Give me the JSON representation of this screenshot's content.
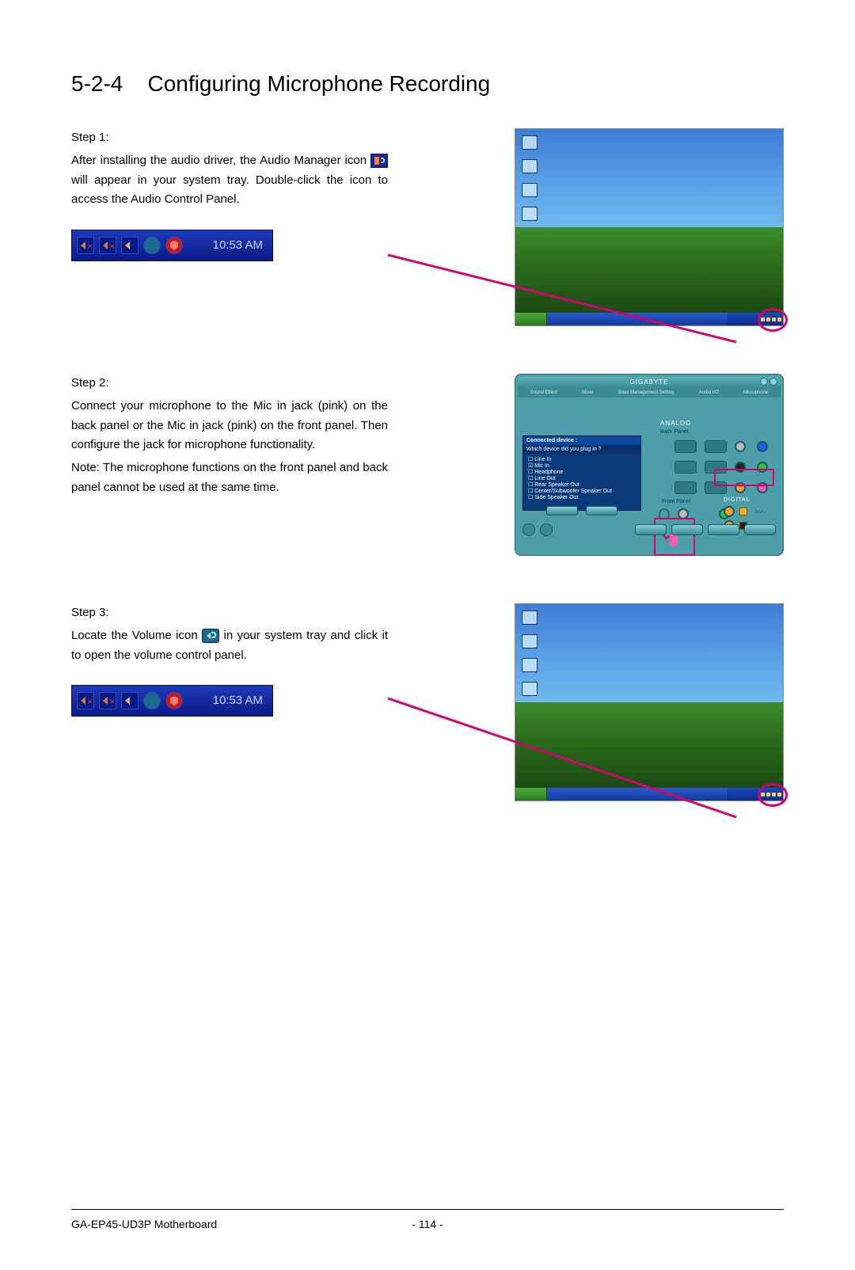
{
  "section": {
    "number": "5-2-4",
    "title": "Configuring Microphone Recording"
  },
  "steps": {
    "s1": {
      "label": "Step 1:",
      "text_before_icon": "After installing the audio driver, the Audio Manager icon ",
      "text_after_icon": " will appear in your system tray. Double-click the icon to access the Audio Control Panel."
    },
    "s2": {
      "label": "Step 2:",
      "p1": "Connect your microphone to the Mic in jack (pink) on the back panel or the Mic in jack (pink) on the front panel. Then configure the jack for microphone functionality.",
      "p2": "Note:  The microphone functions on the front panel and back panel cannot be used at the same time."
    },
    "s3": {
      "label": "Step 3:",
      "text_before_icon": "Locate the Volume icon ",
      "text_after_icon": " in your system tray and click it to open the volume control panel."
    }
  },
  "tray": {
    "clock": "10:53 AM"
  },
  "audio_panel": {
    "brand": "GIGABYTE",
    "tabs": [
      "Sound Effect",
      "Mixer",
      "Bass Management Setting",
      "Audio I/O",
      "Microphone"
    ],
    "analog_label": "ANALOG",
    "back_panel_label": "Back Panel",
    "front_panel_label": "Front Panel",
    "digital_label": "DIGITAL",
    "dialog": {
      "title": "Connected device :",
      "question": "Which device did you plug in ?",
      "options": [
        "Line In",
        "Mic In",
        "Headphone",
        "Line Out",
        "Rear Speaker Out",
        "Center/Subwoofer Speaker Out",
        "Side Speaker Out"
      ],
      "checked_index": 1
    }
  },
  "footer": {
    "model": "GA-EP45-UD3P Motherboard",
    "page": "- 114 -"
  }
}
